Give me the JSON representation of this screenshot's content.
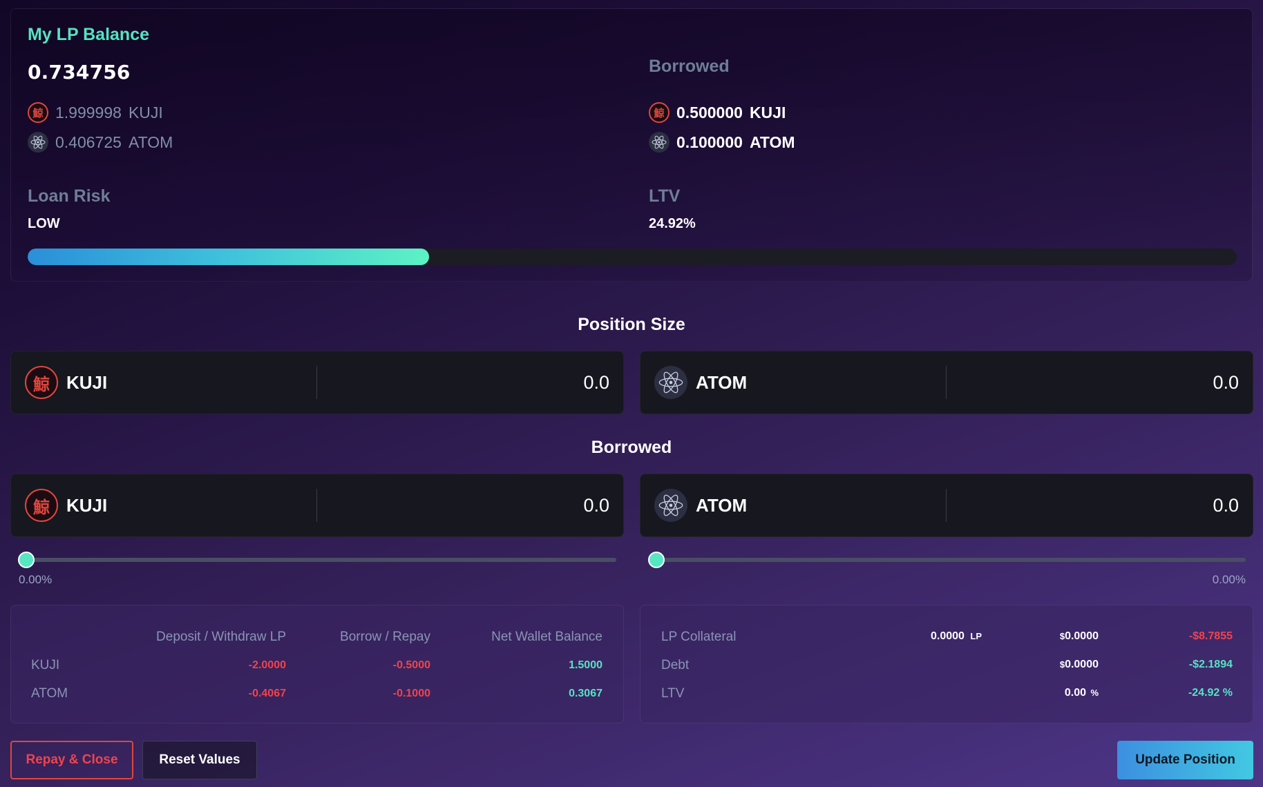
{
  "lp_balance": {
    "title": "My LP Balance",
    "amount": "0.734756",
    "assets": [
      {
        "amount": "1.999998",
        "symbol": "KUJI",
        "icon": "kuji-icon"
      },
      {
        "amount": "0.406725",
        "symbol": "ATOM",
        "icon": "atom-icon"
      }
    ],
    "borrowed_label": "Borrowed",
    "borrowed": [
      {
        "amount": "0.500000",
        "symbol": "KUJI",
        "icon": "kuji-icon"
      },
      {
        "amount": "0.100000",
        "symbol": "ATOM",
        "icon": "atom-icon"
      }
    ],
    "loan_risk_label": "Loan Risk",
    "loan_risk_value": "LOW",
    "ltv_label": "LTV",
    "ltv_value": "24.92%",
    "risk_fraction": 0.332
  },
  "position_size": {
    "title": "Position Size",
    "inputs": [
      {
        "token": "KUJI",
        "value": "0.0"
      },
      {
        "token": "ATOM",
        "value": "0.0"
      }
    ]
  },
  "borrowed_section": {
    "title": "Borrowed",
    "inputs": [
      {
        "token": "KUJI",
        "value": "0.0"
      },
      {
        "token": "ATOM",
        "value": "0.0"
      }
    ]
  },
  "sliders": [
    {
      "percent": "0.00%",
      "fraction": 0
    },
    {
      "percent": "0.00%",
      "fraction": 0
    }
  ],
  "left_table": {
    "headers": [
      "Deposit / Withdraw LP",
      "Borrow / Repay",
      "Net Wallet Balance"
    ],
    "rows": [
      {
        "label": "KUJI",
        "deposit": "-2.0000",
        "borrow": "-0.5000",
        "net": "1.5000"
      },
      {
        "label": "ATOM",
        "deposit": "-0.4067",
        "borrow": "-0.1000",
        "net": "0.3067"
      }
    ]
  },
  "right_table": {
    "rows": [
      {
        "label": "LP Collateral",
        "amount": "0.0000",
        "unit": "LP",
        "usd": "0.0000",
        "change": "-$8.7855"
      },
      {
        "label": "Debt",
        "usd": "0.0000",
        "change": "-$2.1894"
      },
      {
        "label": "LTV",
        "pct": "0.00",
        "pct_unit": "%",
        "change": "-24.92 %"
      }
    ],
    "currency_symbol": "$"
  },
  "buttons": {
    "repay_close": "Repay & Close",
    "reset_values": "Reset Values",
    "update_position": "Update Position"
  },
  "icons": {
    "kuji_glyph": "鯨",
    "atom_glyph": "atom-icon"
  },
  "colors": {
    "accent_teal": "#56e3c1",
    "negative_red": "#f2434a",
    "kuji_red": "#e0463e",
    "muted_text": "#6f7e96"
  }
}
